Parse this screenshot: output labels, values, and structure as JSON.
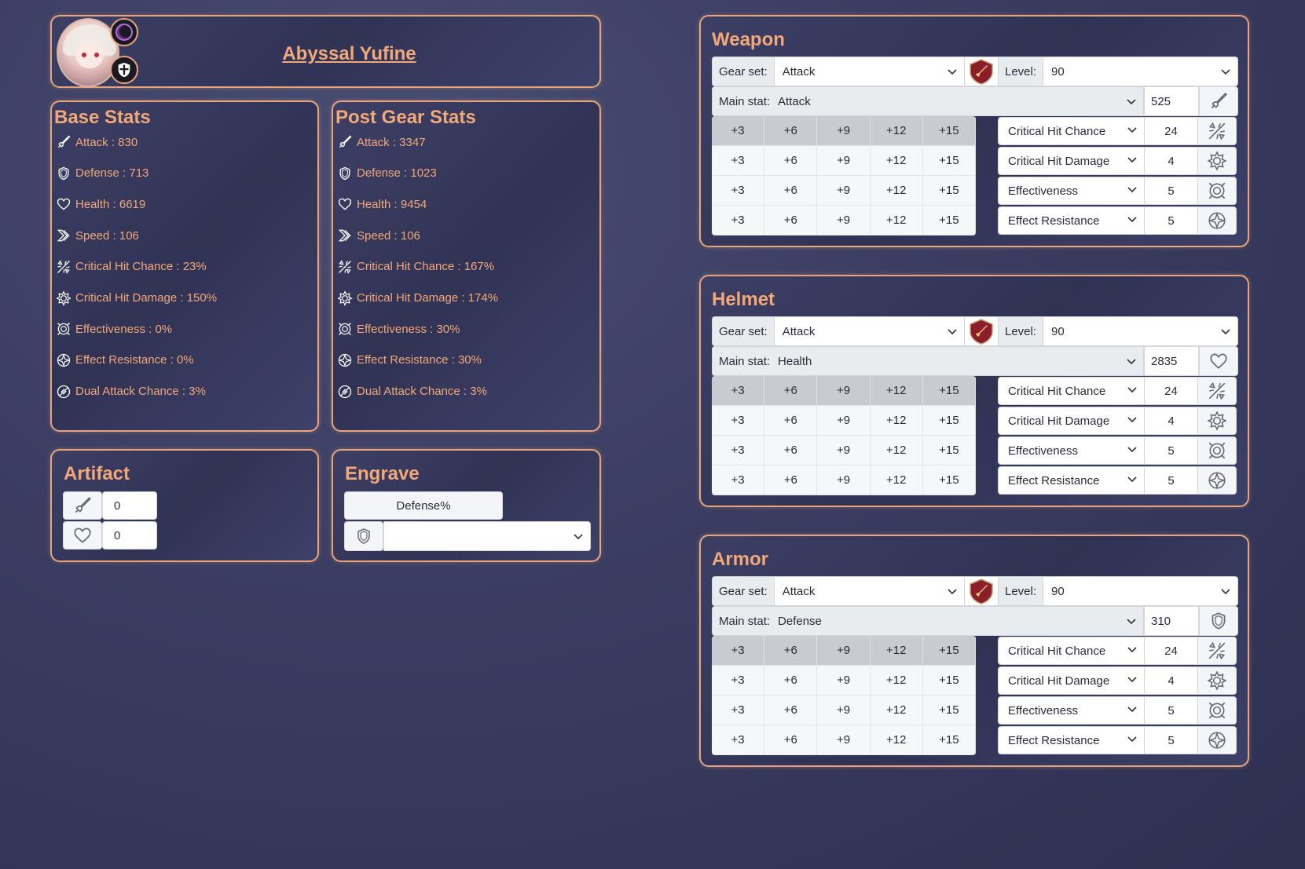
{
  "hero": {
    "name": "Abyssal Yufine"
  },
  "base_stats": {
    "title": "Base Stats",
    "items": [
      {
        "icon": "attack-icon",
        "text": "Attack : 830"
      },
      {
        "icon": "defense-icon",
        "text": "Defense : 713"
      },
      {
        "icon": "health-icon",
        "text": "Health : 6619"
      },
      {
        "icon": "speed-icon",
        "text": "Speed : 106"
      },
      {
        "icon": "crit-chance-icon",
        "text": "Critical Hit Chance : 23%"
      },
      {
        "icon": "crit-damage-icon",
        "text": "Critical Hit Damage : 150%"
      },
      {
        "icon": "effectiveness-icon",
        "text": "Effectiveness : 0%"
      },
      {
        "icon": "effect-resistance-icon",
        "text": "Effect Resistance : 0%"
      },
      {
        "icon": "dual-attack-icon",
        "text": "Dual Attack Chance : 3%"
      }
    ]
  },
  "post_gear_stats": {
    "title": "Post Gear Stats",
    "items": [
      {
        "icon": "attack-icon",
        "text": "Attack : 3347"
      },
      {
        "icon": "defense-icon",
        "text": "Defense : 1023"
      },
      {
        "icon": "health-icon",
        "text": "Health : 9454"
      },
      {
        "icon": "speed-icon",
        "text": "Speed : 106"
      },
      {
        "icon": "crit-chance-icon",
        "text": "Critical Hit Chance : 167%"
      },
      {
        "icon": "crit-damage-icon",
        "text": "Critical Hit Damage : 174%"
      },
      {
        "icon": "effectiveness-icon",
        "text": "Effectiveness : 30%"
      },
      {
        "icon": "effect-resistance-icon",
        "text": "Effect Resistance : 30%"
      },
      {
        "icon": "dual-attack-icon",
        "text": "Dual Attack Chance : 3%"
      }
    ]
  },
  "artifact": {
    "title": "Artifact",
    "attack_value": "0",
    "health_value": "0"
  },
  "engrave": {
    "title": "Engrave",
    "button_label": "Defense%",
    "select_value": ""
  },
  "gear_labels": {
    "gear_set": "Gear set:",
    "level": "Level:",
    "main_stat": "Main stat:"
  },
  "enhance_steps": [
    "+3",
    "+6",
    "+9",
    "+12",
    "+15"
  ],
  "gear": [
    {
      "title": "Weapon",
      "gear_set": "Attack",
      "level": "90",
      "main_stat": "Attack",
      "main_value": "525",
      "main_icon": "attack-icon",
      "substats": [
        {
          "name": "Critical Hit Chance",
          "value": "24",
          "icon": "crit-chance-icon"
        },
        {
          "name": "Critical Hit Damage",
          "value": "4",
          "icon": "crit-damage-icon"
        },
        {
          "name": "Effectiveness",
          "value": "5",
          "icon": "effectiveness-icon"
        },
        {
          "name": "Effect Resistance",
          "value": "5",
          "icon": "effect-resistance-icon"
        }
      ]
    },
    {
      "title": "Helmet",
      "gear_set": "Attack",
      "level": "90",
      "main_stat": "Health",
      "main_value": "2835",
      "main_icon": "health-icon",
      "substats": [
        {
          "name": "Critical Hit Chance",
          "value": "24",
          "icon": "crit-chance-icon"
        },
        {
          "name": "Critical Hit Damage",
          "value": "4",
          "icon": "crit-damage-icon"
        },
        {
          "name": "Effectiveness",
          "value": "5",
          "icon": "effectiveness-icon"
        },
        {
          "name": "Effect Resistance",
          "value": "5",
          "icon": "effect-resistance-icon"
        }
      ]
    },
    {
      "title": "Armor",
      "gear_set": "Attack",
      "level": "90",
      "main_stat": "Defense",
      "main_value": "310",
      "main_icon": "defense-icon",
      "substats": [
        {
          "name": "Critical Hit Chance",
          "value": "24",
          "icon": "crit-chance-icon"
        },
        {
          "name": "Critical Hit Damage",
          "value": "4",
          "icon": "crit-damage-icon"
        },
        {
          "name": "Effectiveness",
          "value": "5",
          "icon": "effectiveness-icon"
        },
        {
          "name": "Effect Resistance",
          "value": "5",
          "icon": "effect-resistance-icon"
        }
      ]
    }
  ],
  "colors": {
    "accent": "#f2a878",
    "border": "#e8a47c",
    "background": "#3b3e62",
    "set_icon": "#8a1f2a"
  }
}
